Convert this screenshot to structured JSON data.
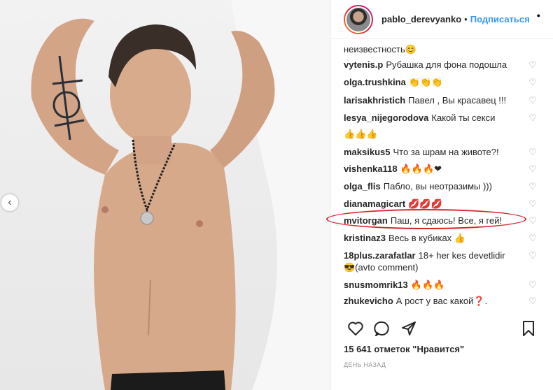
{
  "post": {
    "username": "pablo_derevyanko",
    "follow_label": "Подписаться",
    "separator": "•",
    "likes_text": "15 641 отметок \"Нравится\"",
    "time_text": "день назад"
  },
  "comments": [
    {
      "user": "",
      "text": "неизвестность😊"
    },
    {
      "user": "vytenis.p",
      "text": "Рубашка для фона подошла"
    },
    {
      "user": "olga.trushkina",
      "text": "👏👏👏"
    },
    {
      "user": "larisakhristich",
      "text": "Павел , Вы красавец !!!"
    },
    {
      "user": "lesya_nijegorodova",
      "text": "Какой ты секси"
    },
    {
      "user": "",
      "text": "👍👍👍"
    },
    {
      "user": "maksikus5",
      "text": "Что за шрам на животе?!"
    },
    {
      "user": "vishenka118",
      "text": "🔥🔥🔥❤"
    },
    {
      "user": "olga_flis",
      "text": "Пабло, вы неотразимы )))"
    },
    {
      "user": "dianamagicart",
      "text": "💋💋💋"
    },
    {
      "user": "mvitorgan",
      "text": "Паш, я сдаюсь! Все, я гей!"
    },
    {
      "user": "kristinaz3",
      "text": "Весь в кубиках 👍"
    },
    {
      "user": "18plus.zarafatlar",
      "text": "18+ her kes devetlidir"
    },
    {
      "user": "",
      "text": "😎(avto comment)"
    },
    {
      "user": "snusmomrik13",
      "text": "🔥🔥🔥"
    },
    {
      "user": "zhukevicho",
      "text": "А рост у вас какой❓."
    }
  ],
  "colors": {
    "link_blue": "#3897f0",
    "highlight_red": "#d9232d",
    "text": "#262626",
    "muted": "#999999"
  },
  "icons": {
    "like": "heart-icon",
    "comment": "comment-icon",
    "share": "share-icon",
    "save": "bookmark-icon",
    "prev": "chevron-left-icon"
  }
}
